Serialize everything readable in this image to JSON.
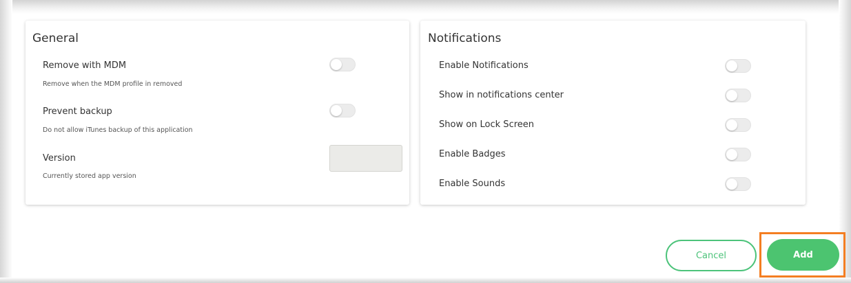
{
  "general": {
    "title": "General",
    "remove_with_mdm": {
      "label": "Remove with MDM",
      "description": "Remove when the MDM profile in removed",
      "enabled": false
    },
    "prevent_backup": {
      "label": "Prevent backup",
      "description": "Do not allow iTunes backup of this application",
      "enabled": false
    },
    "version": {
      "label": "Version",
      "description": "Currently stored app version",
      "value": ""
    }
  },
  "notifications": {
    "title": "Notifications",
    "items": [
      {
        "label": "Enable Notifications",
        "enabled": false
      },
      {
        "label": "Show in notifications center",
        "enabled": false
      },
      {
        "label": "Show on Lock Screen",
        "enabled": false
      },
      {
        "label": "Enable Badges",
        "enabled": false
      },
      {
        "label": "Enable Sounds",
        "enabled": false
      }
    ]
  },
  "actions": {
    "cancel_label": "Cancel",
    "add_label": "Add"
  },
  "colors": {
    "accent_green": "#4cc470",
    "highlight_orange": "#f47e22"
  }
}
